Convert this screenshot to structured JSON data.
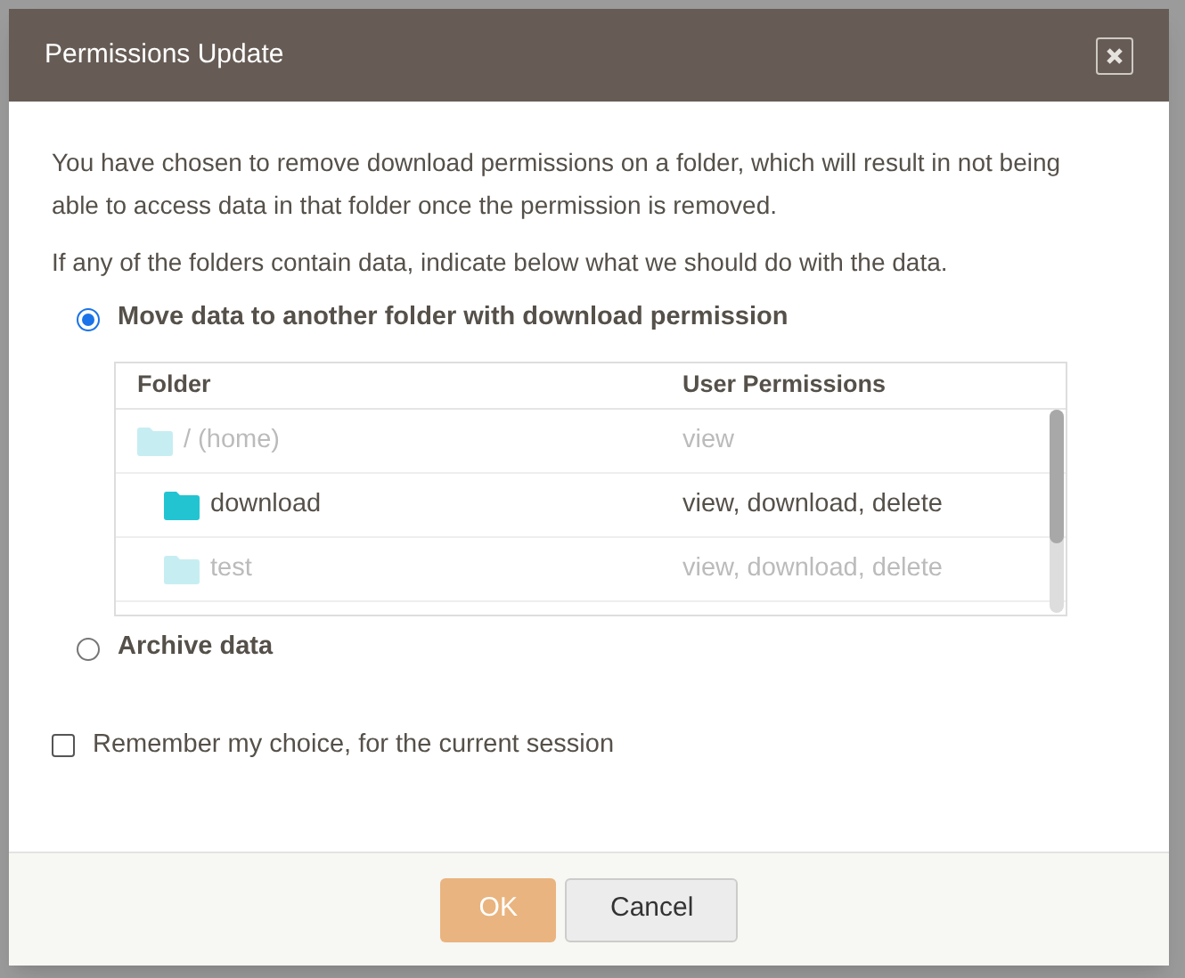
{
  "dialog": {
    "title": "Permissions Update",
    "paragraphs": [
      "You have chosen to remove download permissions on a folder, which will result in not being able to access data in that folder once the permission is removed.",
      "If any of the folders contain data, indicate below what we should do with the data."
    ],
    "options": [
      {
        "label": "Move data to another folder with download permission",
        "selected": true
      },
      {
        "label": "Archive data",
        "selected": false
      }
    ],
    "table": {
      "columns": [
        "Folder",
        "User Permissions"
      ],
      "rows": [
        {
          "folder": "/ (home)",
          "permissions": "view",
          "disabled": true,
          "children": [
            {
              "folder": "download",
              "permissions": "view, download, delete",
              "disabled": false
            },
            {
              "folder": "test",
              "permissions": "view, download, delete",
              "disabled": true
            }
          ]
        }
      ]
    },
    "remember": {
      "label": "Remember my choice, for the current session",
      "checked": false
    },
    "buttons": [
      {
        "label": "OK",
        "kind": "primary"
      },
      {
        "label": "Cancel",
        "kind": "secondary"
      }
    ]
  }
}
